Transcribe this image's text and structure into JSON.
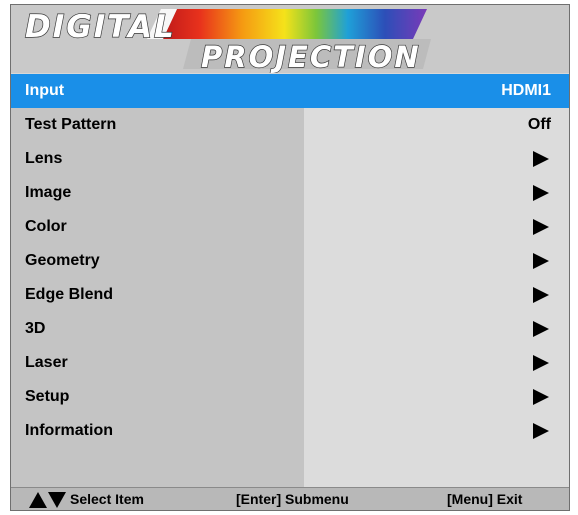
{
  "logo": {
    "line1": "DIGITAL",
    "line2": "PROJECTION"
  },
  "menu": {
    "items": [
      {
        "label": "Input",
        "value": "HDMI1",
        "selected": true
      },
      {
        "label": "Test Pattern",
        "value": "Off"
      },
      {
        "label": "Lens",
        "icon": "submenu-arrow-icon"
      },
      {
        "label": "Image",
        "icon": "submenu-arrow-icon"
      },
      {
        "label": "Color",
        "icon": "submenu-arrow-icon"
      },
      {
        "label": "Geometry",
        "icon": "submenu-arrow-icon"
      },
      {
        "label": "Edge Blend",
        "icon": "submenu-arrow-icon"
      },
      {
        "label": "3D",
        "icon": "submenu-arrow-icon"
      },
      {
        "label": "Laser",
        "icon": "submenu-arrow-icon"
      },
      {
        "label": "Setup",
        "icon": "submenu-arrow-icon"
      },
      {
        "label": "Information",
        "icon": "submenu-arrow-icon"
      }
    ]
  },
  "footer": {
    "select_hint": "Select Item",
    "enter_hint": "[Enter] Submenu",
    "menu_hint": "[Menu] Exit"
  },
  "colors": {
    "selected_row": "#1a8fe8",
    "label_column": "#c4c4c4",
    "value_column": "#dcdcdc",
    "header_background": "#c9c9c9"
  }
}
